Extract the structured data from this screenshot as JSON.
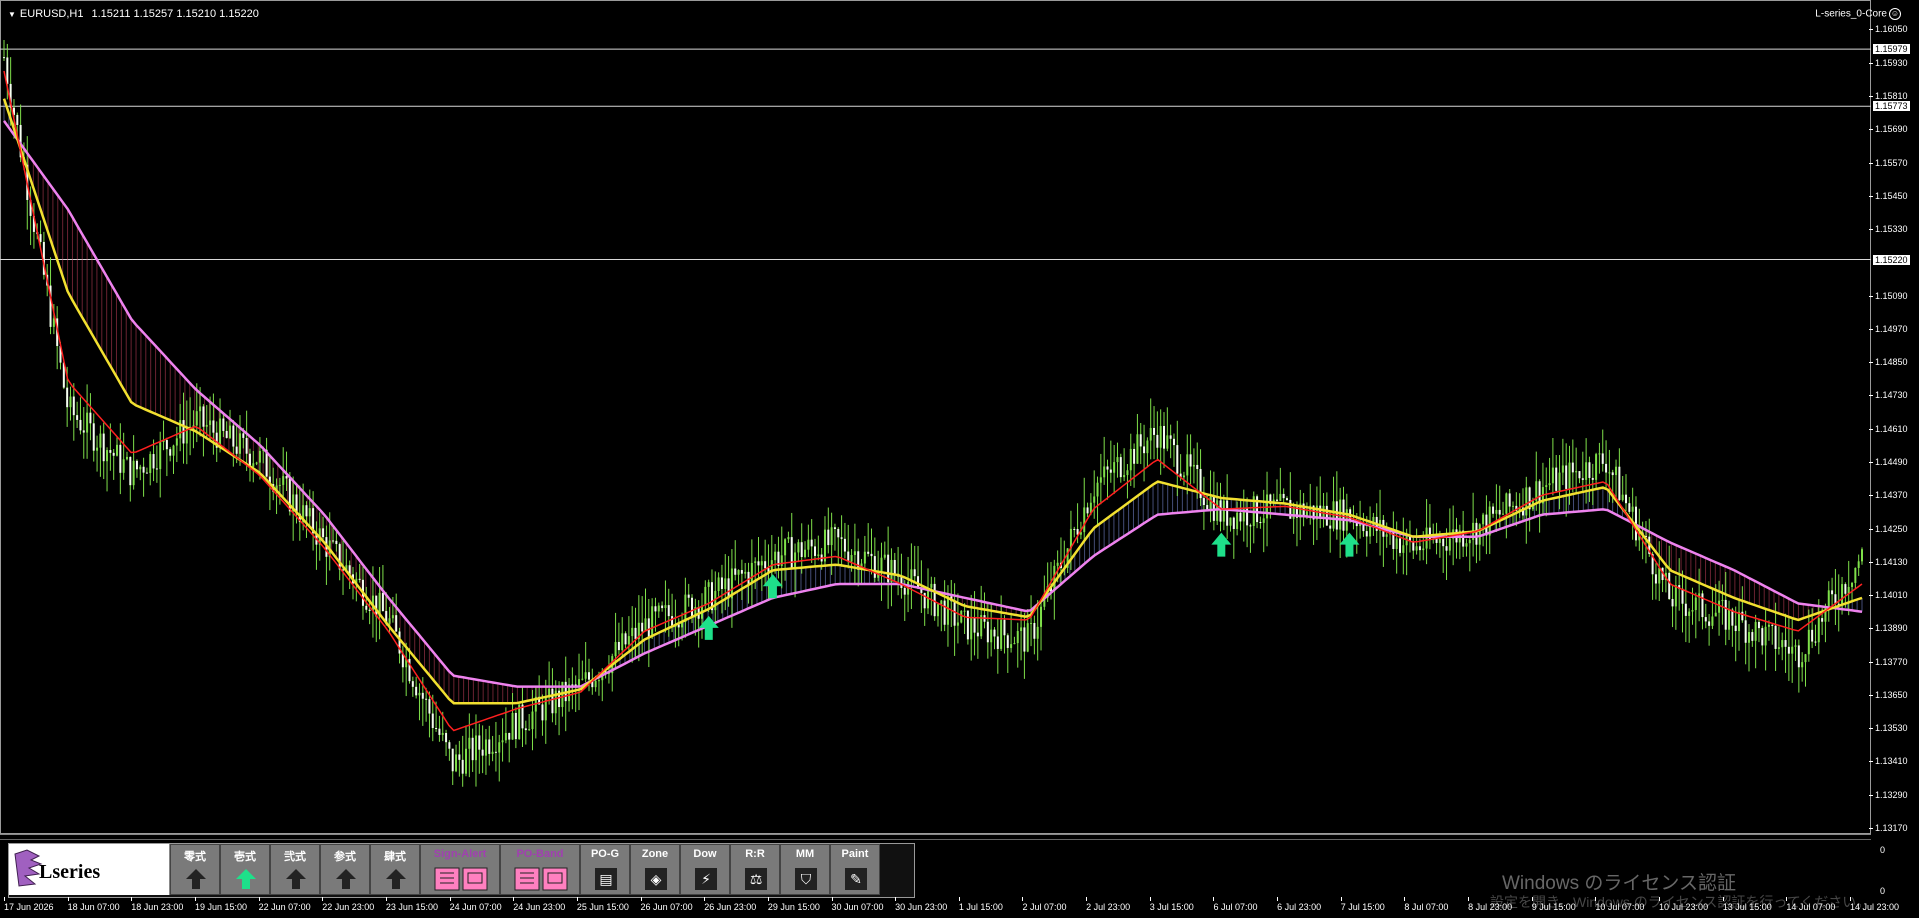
{
  "symbol": {
    "name": "EURUSD,H1",
    "ohlc": "1.15211 1.15257 1.15210 1.15220"
  },
  "indicator_name": "L-series_0-Core",
  "price_ticks": [
    "1.16050",
    "1.15930",
    "1.15810",
    "1.15690",
    "1.15570",
    "1.15450",
    "1.15330",
    "1.15090",
    "1.14970",
    "1.14850",
    "1.14730",
    "1.14610",
    "1.14490",
    "1.14370",
    "1.14250",
    "1.14130",
    "1.14010",
    "1.13890",
    "1.13770",
    "1.13650",
    "1.13530",
    "1.13410",
    "1.13290",
    "1.13170"
  ],
  "price_tags": [
    "1.15979",
    "1.15773",
    "1.15220"
  ],
  "sub_ticks": [
    "0",
    "0"
  ],
  "time_labels": [
    "17 Jun 2026",
    "18 Jun 07:00",
    "18 Jun 23:00",
    "19 Jun 15:00",
    "22 Jun 07:00",
    "22 Jun 23:00",
    "23 Jun 15:00",
    "24 Jun 07:00",
    "24 Jun 23:00",
    "25 Jun 15:00",
    "26 Jun 07:00",
    "26 Jun 23:00",
    "29 Jun 15:00",
    "30 Jun 07:00",
    "30 Jun 23:00",
    "1 Jul 15:00",
    "2 Jul 07:00",
    "2 Jul 23:00",
    "3 Jul 15:00",
    "6 Jul 07:00",
    "6 Jul 23:00",
    "7 Jul 15:00",
    "8 Jul 07:00",
    "8 Jul 23:00",
    "9 Jul 15:00",
    "10 Jul 07:00",
    "10 Jul 23:00",
    "13 Jul 15:00",
    "14 Jul 07:00",
    "14 Jul 23:00"
  ],
  "panel": {
    "logo": "L",
    "logo_rest": "series",
    "buttons": [
      {
        "label": "零式",
        "icon": "arrow-up-icon"
      },
      {
        "label": "壱式",
        "icon": "arrow-up-green-icon"
      },
      {
        "label": "弐式",
        "icon": "arrow-up-icon"
      },
      {
        "label": "参式",
        "icon": "arrow-up-icon"
      },
      {
        "label": "肆式",
        "icon": "arrow-up-icon"
      },
      {
        "label": "Sign-Alert",
        "icon": "alert-icon"
      },
      {
        "label": "PO-Band",
        "icon": "band-icon"
      },
      {
        "label": "PO-G",
        "icon": "bars-icon"
      },
      {
        "label": "Zone",
        "icon": "zone-icon"
      },
      {
        "label": "Dow",
        "icon": "dow-icon"
      },
      {
        "label": "R:R",
        "icon": "scale-icon"
      },
      {
        "label": "MM",
        "icon": "shield-icon"
      },
      {
        "label": "Paint",
        "icon": "pencil-icon"
      }
    ]
  },
  "watermark": {
    "line1": "Windows のライセンス認証",
    "line2": "設定を開き、Windows のライセンス認証を行ってください。"
  },
  "colors": {
    "up": "#7fe04a",
    "down": "#e02020",
    "fast": "#ff2020",
    "mid": "#f2e030",
    "slow": "#ee82ee",
    "slow_alt": "#b89ef0",
    "arrow": "#1ee08a"
  },
  "chart_data": {
    "type": "line",
    "title": "EURUSD,H1",
    "x": [
      "17 Jun 2026",
      "18 Jun 07:00",
      "18 Jun 23:00",
      "19 Jun 15:00",
      "22 Jun 07:00",
      "22 Jun 23:00",
      "23 Jun 15:00",
      "24 Jun 07:00",
      "24 Jun 23:00",
      "25 Jun 15:00",
      "26 Jun 07:00",
      "26 Jun 23:00",
      "29 Jun 15:00",
      "30 Jun 07:00",
      "30 Jun 23:00",
      "1 Jul 15:00",
      "2 Jul 07:00",
      "2 Jul 23:00",
      "3 Jul 15:00",
      "6 Jul 07:00",
      "6 Jul 23:00",
      "7 Jul 15:00",
      "8 Jul 07:00",
      "8 Jul 23:00",
      "9 Jul 15:00",
      "10 Jul 07:00",
      "10 Jul 23:00",
      "13 Jul 15:00",
      "14 Jul 07:00",
      "14 Jul 23:00"
    ],
    "ylim": [
      1.1317,
      1.1612
    ],
    "series": [
      {
        "name": "Close",
        "values": [
          1.1595,
          1.1468,
          1.1445,
          1.1464,
          1.145,
          1.142,
          1.1392,
          1.134,
          1.1355,
          1.1368,
          1.139,
          1.14,
          1.1415,
          1.142,
          1.1408,
          1.139,
          1.1385,
          1.144,
          1.146,
          1.143,
          1.1432,
          1.143,
          1.1418,
          1.1425,
          1.144,
          1.145,
          1.14,
          1.1392,
          1.138,
          1.1415
        ]
      },
      {
        "name": "Fast",
        "values": [
          1.159,
          1.1478,
          1.1452,
          1.1462,
          1.1444,
          1.1418,
          1.1388,
          1.1352,
          1.136,
          1.1366,
          1.1388,
          1.1398,
          1.1412,
          1.1415,
          1.1405,
          1.1393,
          1.1392,
          1.1432,
          1.145,
          1.1432,
          1.1433,
          1.1429,
          1.142,
          1.1424,
          1.1437,
          1.1442,
          1.1405,
          1.1395,
          1.1388,
          1.1405
        ]
      },
      {
        "name": "Mid",
        "values": [
          1.158,
          1.151,
          1.147,
          1.146,
          1.1445,
          1.142,
          1.139,
          1.1362,
          1.1362,
          1.1367,
          1.1385,
          1.1396,
          1.141,
          1.1412,
          1.1408,
          1.1397,
          1.1393,
          1.1425,
          1.1442,
          1.1436,
          1.1434,
          1.143,
          1.1422,
          1.1424,
          1.1435,
          1.144,
          1.141,
          1.14,
          1.1392,
          1.14
        ]
      },
      {
        "name": "Slow",
        "values": [
          1.1572,
          1.154,
          1.15,
          1.1475,
          1.1455,
          1.143,
          1.14,
          1.1372,
          1.1368,
          1.1368,
          1.138,
          1.139,
          1.14,
          1.1405,
          1.1405,
          1.14,
          1.1395,
          1.1415,
          1.143,
          1.1432,
          1.143,
          1.1428,
          1.1422,
          1.1422,
          1.143,
          1.1432,
          1.142,
          1.141,
          1.1398,
          1.1395
        ]
      }
    ],
    "horizontal_lines": [
      1.15979,
      1.15773,
      1.1522
    ],
    "signals": [
      {
        "x": "26 Jun 23:00",
        "type": "buy"
      },
      {
        "x": "29 Jun 15:00",
        "type": "buy"
      },
      {
        "x": "6 Jul 07:00",
        "type": "buy"
      },
      {
        "x": "7 Jul 15:00",
        "type": "buy"
      }
    ],
    "grid": false,
    "legend": "none"
  }
}
